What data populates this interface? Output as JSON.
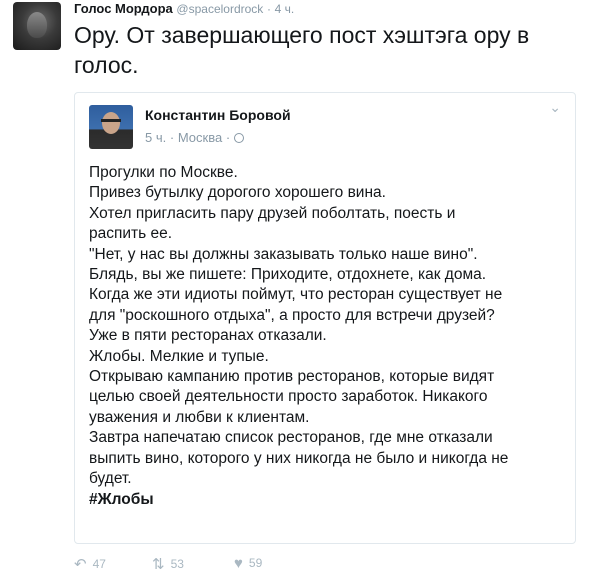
{
  "tweet": {
    "author_name": "Голос Мордора",
    "handle": "@spacelordrock",
    "separator": "·",
    "time": "4 ч.",
    "text": "Ору. От завершающего пост хэштэга ору в голос."
  },
  "quoted": {
    "author_name": "Константин Боровой",
    "time": "5 ч.",
    "separator": "·",
    "location": "Москва",
    "lines": [
      "Прогулки по Москве.",
      "Привез бутылку дорогого хорошего вина.",
      "Хотел пригласить пару друзей поболтать, поесть и",
      "распить ее.",
      "\"Нет, у нас вы должны заказывать только наше вино\".",
      "Блядь, вы же пишете: Приходите, отдохнете, как дома.",
      "Когда же эти идиоты поймут, что ресторан существует не",
      "для \"роскошного отдыха\", а просто для встречи друзей?",
      "Уже в пяти ресторанах отказали.",
      "Жлобы. Мелкие и тупые.",
      "Открываю кампанию против ресторанов, которые видят",
      "целью своей деятельности просто заработок. Никакого",
      "уважения и любви к клиентам.",
      "Завтра напечатаю список ресторанов, где мне отказали",
      "выпить вино, которого у них никогда не было и никогда не",
      "будет."
    ],
    "hashtag": "#Жлобы"
  },
  "actions": {
    "reply": {
      "icon": "reply-icon",
      "count": "47"
    },
    "retweet": {
      "icon": "retweet-icon",
      "count": "53"
    },
    "like": {
      "icon": "heart-icon",
      "count": "59"
    }
  }
}
